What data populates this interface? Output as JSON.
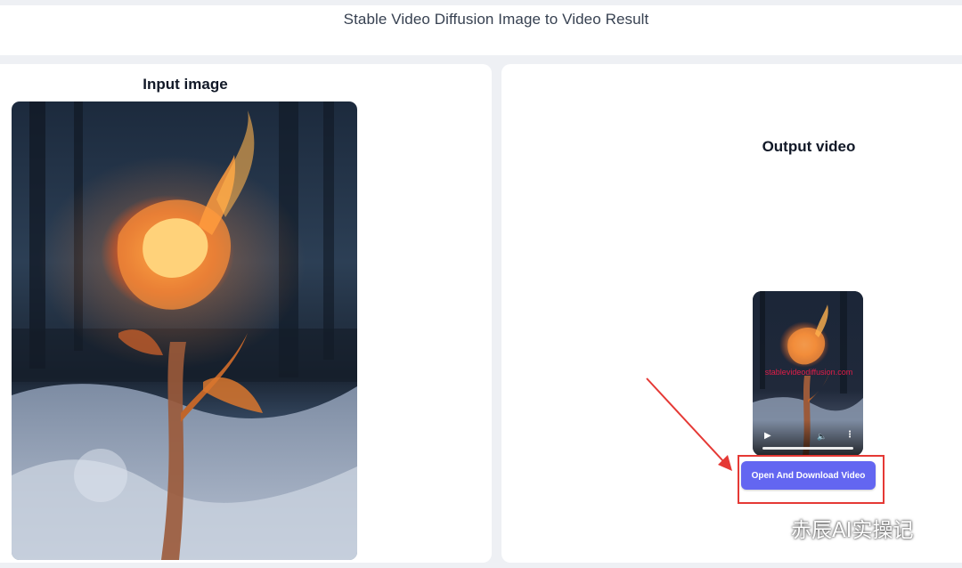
{
  "page": {
    "header": "Stable Video Diffusion Image to Video Result"
  },
  "input_panel": {
    "title": "Input image"
  },
  "output_panel": {
    "title": "Output video",
    "video": {
      "watermark": "stablevideodiffusion.com",
      "controls": {
        "play_icon": "play-icon",
        "volume_icon": "volume-icon",
        "more_icon": "more-options-icon"
      }
    },
    "download_button": "Open And Download Video"
  },
  "annotation": {
    "highlight_color": "#e53935",
    "arrow_color": "#e53935"
  },
  "source_watermark": {
    "text": "赤辰AI实操记",
    "icon": "wechat-icon"
  },
  "colors": {
    "accent": "#6366f1",
    "background": "#eef0f4",
    "card": "#ffffff"
  }
}
